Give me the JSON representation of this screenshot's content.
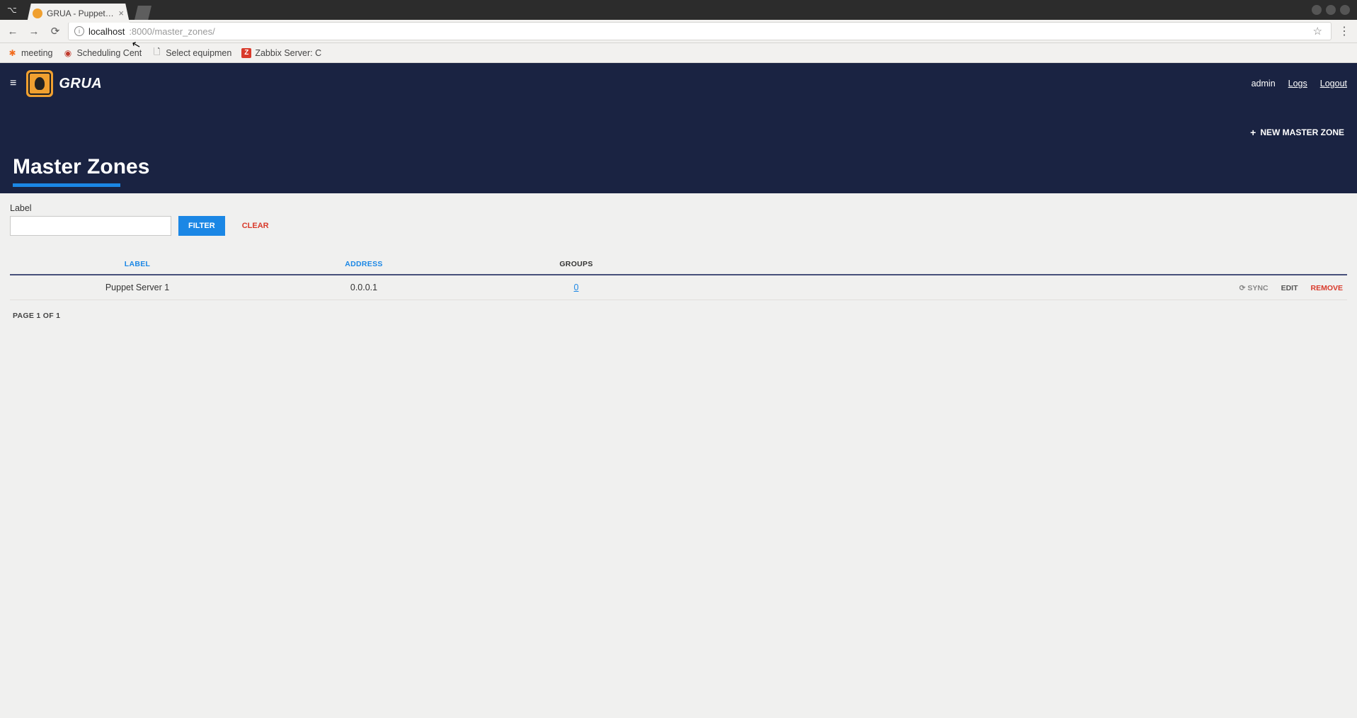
{
  "browser": {
    "tab_title": "GRUA - Puppet Clas",
    "url_host": "localhost",
    "url_port_path": ":8000/master_zones/",
    "bookmarks": [
      {
        "label": "meeting",
        "icon": "orange"
      },
      {
        "label": "Scheduling Cent",
        "icon": "red"
      },
      {
        "label": "Select equipmen",
        "icon": "file"
      },
      {
        "label": "Zabbix Server: C",
        "icon": "zbox"
      }
    ]
  },
  "header": {
    "brand": "GRUA",
    "user": "admin",
    "logs_label": "Logs",
    "logout_label": "Logout"
  },
  "hero": {
    "new_button": "NEW MASTER ZONE",
    "title": "Master Zones"
  },
  "filter": {
    "label": "Label",
    "input_value": "",
    "filter_btn": "FILTER",
    "clear_btn": "CLEAR"
  },
  "table": {
    "columns": {
      "label": "LABEL",
      "address": "ADDRESS",
      "groups": "GROUPS"
    },
    "rows": [
      {
        "label": "Puppet Server 1",
        "address": "0.0.0.1",
        "groups": "0"
      }
    ],
    "actions": {
      "sync": "SYNC",
      "edit": "EDIT",
      "remove": "REMOVE"
    }
  },
  "pagination": "PAGE 1 OF 1"
}
